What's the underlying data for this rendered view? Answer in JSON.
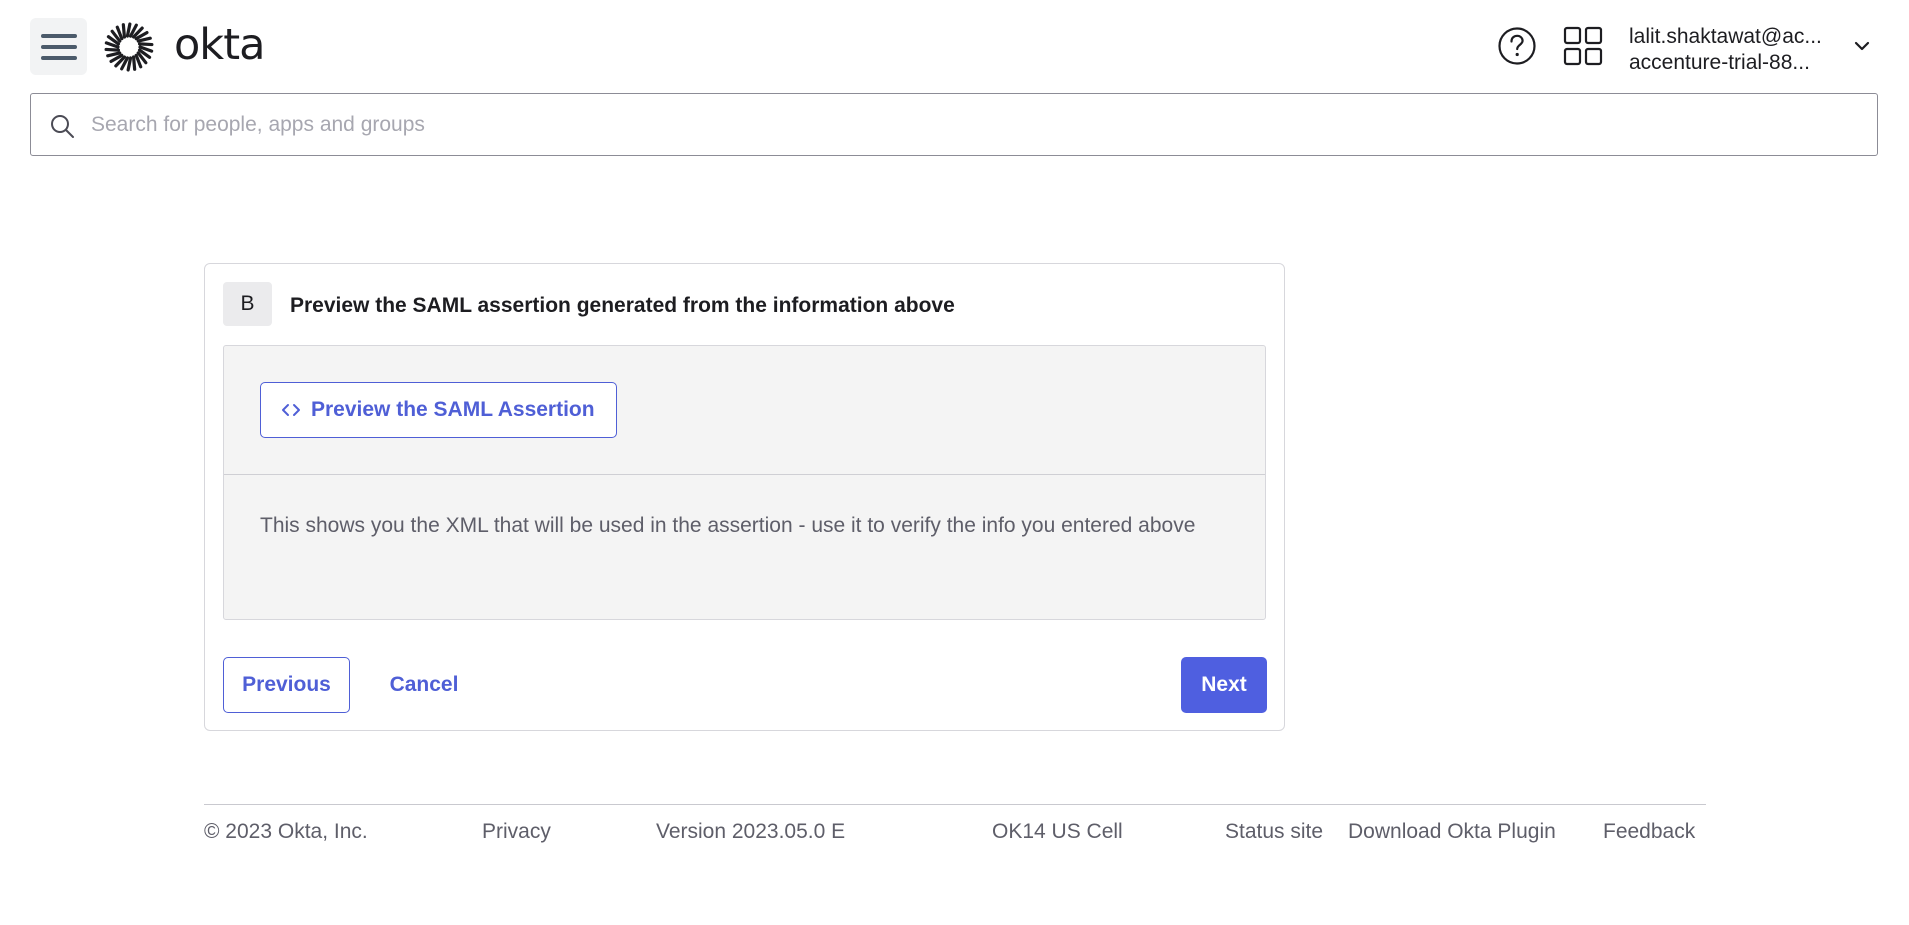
{
  "header": {
    "menu_icon": "hamburger-menu-icon",
    "logo_text": "okta",
    "help_icon": "help-circle-icon",
    "apps_icon": "app-grid-icon",
    "user": {
      "email": "lalit.shaktawat@ac...",
      "org": "accenture-trial-88...",
      "chevron_icon": "chevron-down-icon"
    }
  },
  "search": {
    "placeholder": "Search for people, apps and groups",
    "value": "",
    "icon": "search-icon"
  },
  "card": {
    "step_letter": "B",
    "step_title": "Preview the SAML assertion generated from the information above",
    "preview_button_label": "Preview the SAML Assertion",
    "preview_button_icon": "code-icon",
    "description": "This shows you the XML that will be used in the assertion - use it to verify the info you entered above",
    "previous_label": "Previous",
    "cancel_label": "Cancel",
    "next_label": "Next"
  },
  "footer": {
    "copyright": "© 2023 Okta, Inc.",
    "privacy": "Privacy",
    "version": "Version 2023.05.0 E",
    "cell": "OK14 US Cell",
    "status_site": "Status site",
    "download_plugin": "Download Okta Plugin",
    "feedback": "Feedback"
  },
  "colors": {
    "accent": "#4f5fd6",
    "primary_button": "#4f5fe0",
    "panel_bg": "#f4f4f4"
  }
}
